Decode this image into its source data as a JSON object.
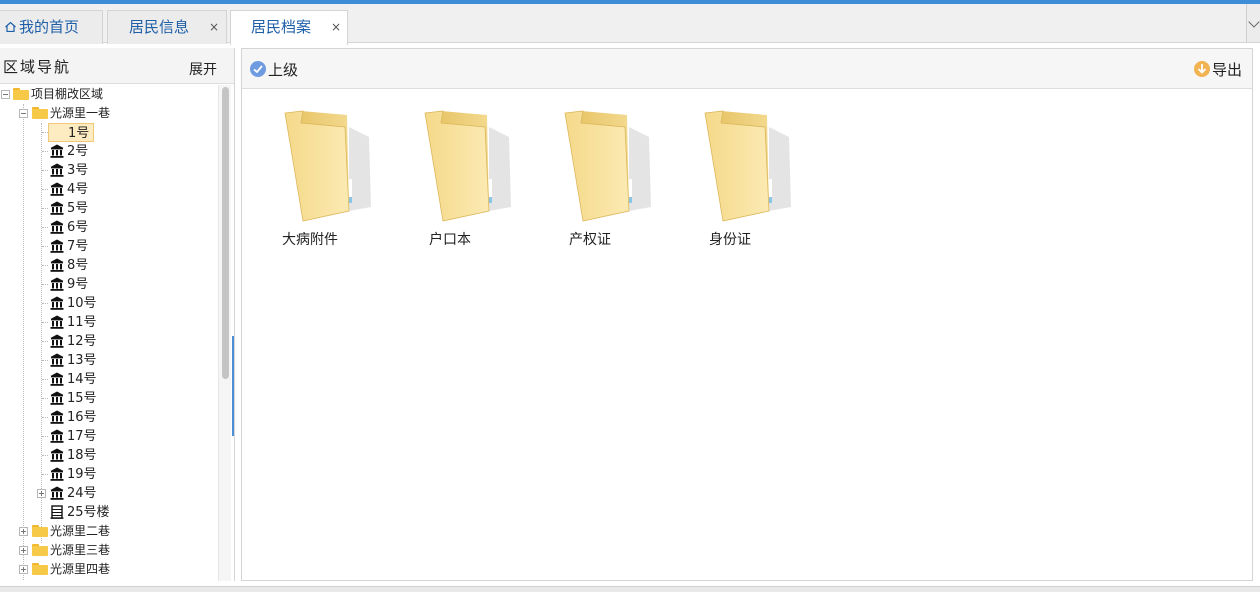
{
  "tabs": [
    {
      "label": "我的首页",
      "icon": "home-icon",
      "closable": false
    },
    {
      "label": "居民信息",
      "closable": true,
      "close_glyph": "×"
    },
    {
      "label": "居民档案",
      "closable": true,
      "close_glyph": "×",
      "active": true
    }
  ],
  "nav": {
    "title": "区域导航",
    "expand_label": "展开",
    "tree": {
      "root": "项目棚改区域",
      "lane1": "光源里一巷",
      "houses": [
        "1号",
        "2号",
        "3号",
        "4号",
        "5号",
        "6号",
        "7号",
        "8号",
        "9号",
        "10号",
        "11号",
        "12号",
        "13号",
        "14号",
        "15号",
        "16号",
        "17号",
        "18号",
        "19号",
        "24号"
      ],
      "building": "25号楼",
      "lane2": "光源里二巷",
      "lane3": "光源里三巷",
      "lane4": "光源里四巷",
      "selected": "1号"
    }
  },
  "toolbar": {
    "up_label": "上级",
    "export_label": "导出"
  },
  "folders": [
    "大病附件",
    "户口本",
    "产权证",
    "身份证"
  ],
  "colors": {
    "accent": "#3d8ed6",
    "tab_text": "#1f5fa8",
    "folder": "#f7c948",
    "selection": "#fdebc2"
  }
}
